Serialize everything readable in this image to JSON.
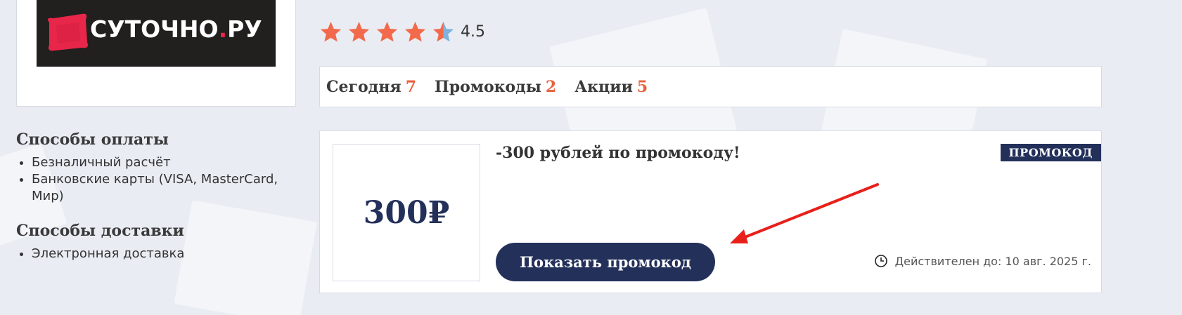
{
  "logo": {
    "text_main": "СУТОЧНО",
    "text_dot": ".",
    "text_tld": "РУ",
    "brand_color": "#e8264a",
    "bg_color": "#221f1f"
  },
  "rating": {
    "value": "4.5",
    "stars": 4.5,
    "max": 5,
    "star_color": "#f26a4b",
    "half_color": "#7fb3de"
  },
  "tabs": [
    {
      "label": "Сегодня",
      "count": "7"
    },
    {
      "label": "Промокоды",
      "count": "2"
    },
    {
      "label": "Акции",
      "count": "5"
    }
  ],
  "sidebar": {
    "payment": {
      "title": "Способы оплаты",
      "items": [
        "Безналичный расчёт",
        "Банковские карты (VISA, MasterCard, Мир)"
      ]
    },
    "delivery": {
      "title": "Способы доставки",
      "items": [
        "Электронная доставка"
      ]
    }
  },
  "offer": {
    "thumb": "300₽",
    "title": "-300 рублей по промокоду!",
    "badge": "ПРОМОКОД",
    "button": "Показать промокод",
    "validity": "Действителен до: 10 авг. 2025 г.",
    "accent": "#23305a"
  },
  "annotation": {
    "arrow_color": "#e8201a"
  }
}
